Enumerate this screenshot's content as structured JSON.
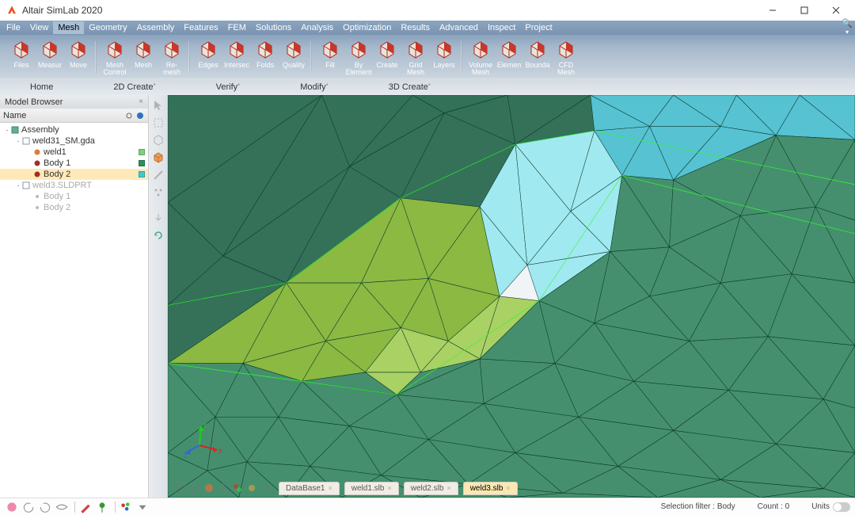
{
  "app_title": "Altair SimLab 2020",
  "menu": [
    "File",
    "View",
    "Mesh",
    "Geometry",
    "Assembly",
    "Features",
    "FEM",
    "Solutions",
    "Analysis",
    "Optimization",
    "Results",
    "Advanced",
    "Inspect",
    "Project"
  ],
  "active_menu": "Mesh",
  "ribbon_groups": [
    {
      "items": [
        {
          "l": "Files"
        },
        {
          "l": "Measure",
          "l1": "Measur"
        },
        {
          "l": "Move"
        }
      ]
    },
    {
      "items": [
        {
          "l": "Mesh Control",
          "l1": "Mesh",
          "l2": "Control"
        },
        {
          "l": "Mesh"
        },
        {
          "l": "Re-mesh",
          "l1": "Re-",
          "l2": "mesh"
        }
      ]
    },
    {
      "items": [
        {
          "l": "Edges"
        },
        {
          "l": "Intersections",
          "l1": "Intersec"
        },
        {
          "l": "Folds"
        },
        {
          "l": "Quality"
        }
      ]
    },
    {
      "items": [
        {
          "l": "Fill"
        },
        {
          "l": "By Element",
          "l1": "By",
          "l2": "Element"
        },
        {
          "l": "Create"
        },
        {
          "l": "Grid Mesh",
          "l1": "Grid",
          "l2": "Mesh"
        },
        {
          "l": "Layers"
        }
      ]
    },
    {
      "items": [
        {
          "l": "Volume Mesh",
          "l1": "Volume",
          "l2": "Mesh"
        },
        {
          "l": "Element Boundary",
          "l1": "Elemen",
          "l2": ""
        },
        {
          "l": "Boundary",
          "l1": "Bounda",
          "l2": ""
        },
        {
          "l": "CFD Mesh",
          "l1": "CFD",
          "l2": "Mesh"
        }
      ]
    }
  ],
  "subtabs": [
    "Home",
    "2D Create",
    "Verify",
    "Modify",
    "3D Create"
  ],
  "browser": {
    "title": "Model Browser",
    "header": "Name",
    "tree": [
      {
        "depth": 0,
        "exp": "-",
        "icon": "asm",
        "label": "Assembly"
      },
      {
        "depth": 1,
        "exp": "-",
        "icon": "file",
        "label": "weld31_SM.gda"
      },
      {
        "depth": 2,
        "exp": "",
        "icon": "body-o",
        "label": "weld1",
        "color": "#7dd07d"
      },
      {
        "depth": 2,
        "exp": "",
        "icon": "body-r",
        "label": "Body 1",
        "color": "#2e8f5a"
      },
      {
        "depth": 2,
        "exp": "",
        "icon": "body-r",
        "label": "Body 2",
        "color": "#3fc9d6",
        "selected": true
      },
      {
        "depth": 1,
        "exp": "-",
        "icon": "file",
        "label": "weld3.SLDPRT",
        "dim": true
      },
      {
        "depth": 2,
        "exp": "",
        "icon": "dot",
        "label": "Body 1",
        "dim": true
      },
      {
        "depth": 2,
        "exp": "",
        "icon": "dot",
        "label": "Body 2",
        "dim": true
      }
    ]
  },
  "vp_tabs": [
    {
      "label": "DataBase1"
    },
    {
      "label": "weld1.slb"
    },
    {
      "label": "weld2.slb"
    },
    {
      "label": "weld3.slb",
      "active": true
    }
  ],
  "status": {
    "filter_label": "Selection filter : ",
    "filter_value": "Body",
    "count_label": "Count : ",
    "count_value": "0",
    "units_label": "Units"
  },
  "triad": {
    "x": "X",
    "y": "Y",
    "z": "Z"
  }
}
